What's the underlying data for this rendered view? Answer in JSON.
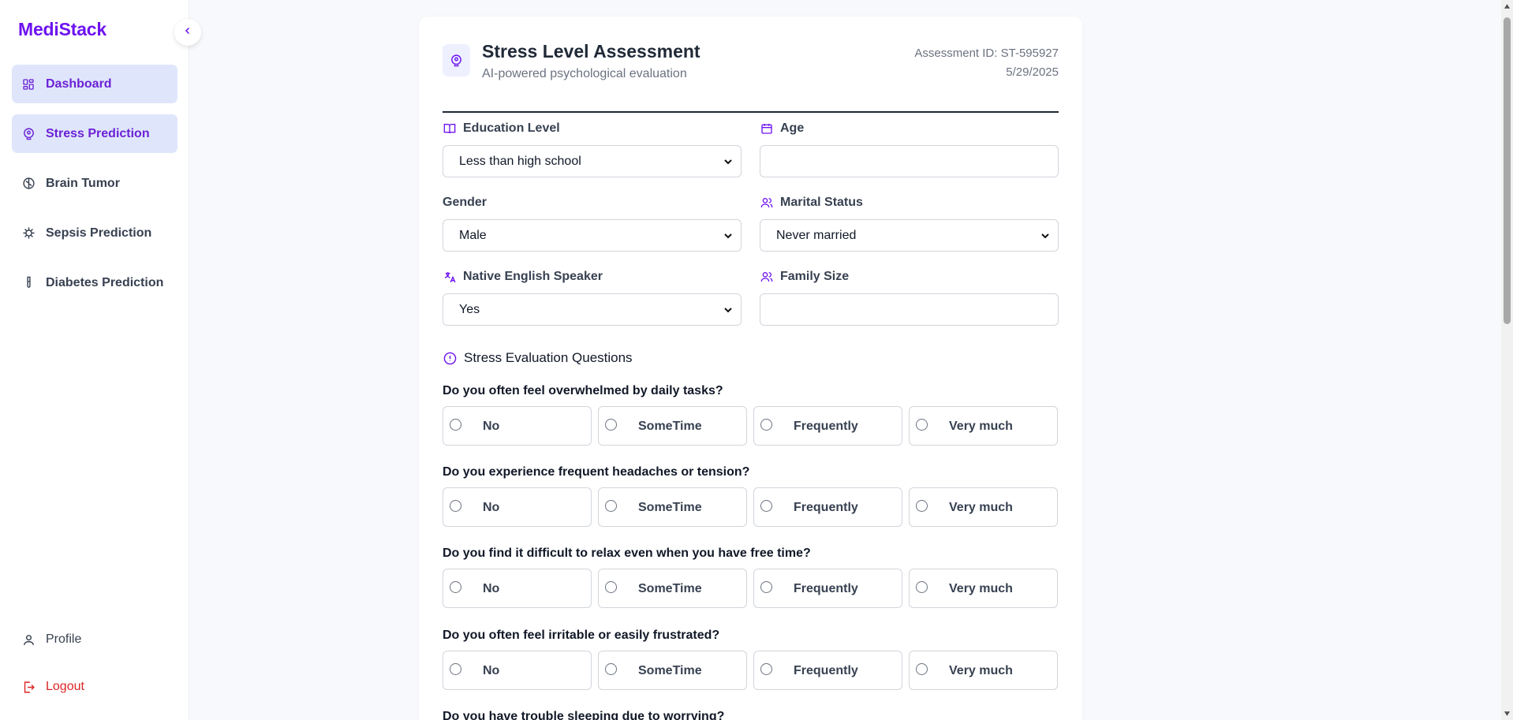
{
  "brand": "MediStack",
  "sidebar": {
    "items": [
      {
        "label": "Dashboard",
        "icon": "dashboard-icon"
      },
      {
        "label": "Stress Prediction",
        "icon": "brain-icon"
      },
      {
        "label": "Brain Tumor",
        "icon": "brain-circuit-icon"
      },
      {
        "label": "Sepsis Prediction",
        "icon": "virus-icon"
      },
      {
        "label": "Diabetes Prediction",
        "icon": "test-tube-icon"
      }
    ],
    "bottom": [
      {
        "label": "Profile",
        "icon": "user-icon"
      },
      {
        "label": "Logout",
        "icon": "logout-icon"
      }
    ]
  },
  "header": {
    "title": "Stress Level Assessment",
    "subtitle": "AI-powered psychological evaluation",
    "assessment_id": "Assessment ID: ST-595927",
    "date": "5/29/2025"
  },
  "form": {
    "education": {
      "label": "Education Level",
      "value": "Less than high school"
    },
    "age": {
      "label": "Age",
      "value": ""
    },
    "gender": {
      "label": "Gender",
      "value": "Male"
    },
    "marital": {
      "label": "Marital Status",
      "value": "Never married"
    },
    "native": {
      "label": "Native English Speaker",
      "value": "Yes"
    },
    "family": {
      "label": "Family Size",
      "value": ""
    }
  },
  "section_title": "Stress Evaluation Questions",
  "options": [
    "No",
    "SomeTime",
    "Frequently",
    "Very much"
  ],
  "questions": [
    "Do you often feel overwhelmed by daily tasks?",
    "Do you experience frequent headaches or tension?",
    "Do you find it difficult to relax even when you have free time?",
    "Do you often feel irritable or easily frustrated?",
    "Do you have trouble sleeping due to worrying?"
  ],
  "colors": {
    "accent": "#6d12f0",
    "active_bg": "#dfe6fb",
    "logout": "#dc2626"
  }
}
